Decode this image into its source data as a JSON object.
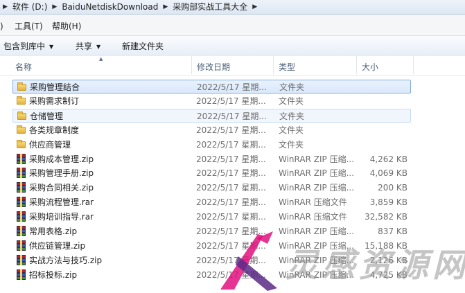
{
  "address_bar": {
    "crumbs": [
      "软件 (D:)",
      "BaiduNetdiskDownload",
      "采购部实战工具大全"
    ]
  },
  "menu": {
    "items": [
      ")",
      "工具(T)",
      "帮助(H)"
    ]
  },
  "toolbar": {
    "include_library": "包含到库中",
    "share": "共享",
    "new_folder": "新建文件夹"
  },
  "columns": {
    "name": "名称",
    "date": "修改日期",
    "type": "类型",
    "size": "大小"
  },
  "files": [
    {
      "name": "采购管理结合",
      "date": "2022/5/17 星期...",
      "type": "文件夹",
      "size": "",
      "icon": "folder-icon",
      "state": "selected"
    },
    {
      "name": "采购需求制订",
      "date": "2022/5/17 星期...",
      "type": "文件夹",
      "size": "",
      "icon": "folder-icon",
      "state": ""
    },
    {
      "name": "仓储管理",
      "date": "2022/5/17 星期...",
      "type": "文件夹",
      "size": "",
      "icon": "folder-icon",
      "state": "hover"
    },
    {
      "name": "各类规章制度",
      "date": "2022/5/17 星期...",
      "type": "文件夹",
      "size": "",
      "icon": "folder-icon",
      "state": ""
    },
    {
      "name": "供应商管理",
      "date": "2022/5/17 星期...",
      "type": "文件夹",
      "size": "",
      "icon": "folder-icon",
      "state": ""
    },
    {
      "name": "采购成本管理.zip",
      "date": "2022/5/17 星期...",
      "type": "WinRAR ZIP 压缩...",
      "size": "4,262 KB",
      "icon": "winrar-icon",
      "state": ""
    },
    {
      "name": "采购管理手册.zip",
      "date": "2022/5/17 星期...",
      "type": "WinRAR ZIP 压缩...",
      "size": "4,069 KB",
      "icon": "winrar-icon",
      "state": ""
    },
    {
      "name": "采购合同相关.zip",
      "date": "2022/5/17 星期...",
      "type": "WinRAR ZIP 压缩...",
      "size": "200 KB",
      "icon": "winrar-icon",
      "state": ""
    },
    {
      "name": "采购流程管理.rar",
      "date": "2022/5/17 星期...",
      "type": "WinRAR 压缩文件",
      "size": "3,859 KB",
      "icon": "winrar-icon",
      "state": ""
    },
    {
      "name": "采购培训指导.rar",
      "date": "2022/5/17 星期...",
      "type": "WinRAR 压缩文件",
      "size": "32,582 KB",
      "icon": "winrar-icon",
      "state": ""
    },
    {
      "name": "常用表格.zip",
      "date": "2022/5/17 星期...",
      "type": "WinRAR ZIP 压缩...",
      "size": "837 KB",
      "icon": "winrar-icon",
      "state": ""
    },
    {
      "name": "供应链管理.zip",
      "date": "2022/5/17 星期...",
      "type": "WinRAR ZIP 压缩...",
      "size": "15,188 KB",
      "icon": "winrar-icon",
      "state": ""
    },
    {
      "name": "实战方法与技巧.zip",
      "date": "2022/5/17 星期...",
      "type": "WinRAR ZIP 压缩...",
      "size": "2,126 KB",
      "icon": "winrar-icon",
      "state": ""
    },
    {
      "name": "招标投标.zip",
      "date": "2022/5/17 星期...",
      "type": "WinRAR ZIP 压缩...",
      "size": "4,725 KB",
      "icon": "winrar-icon",
      "state": ""
    }
  ],
  "watermark": {
    "text": "灵感资源网"
  },
  "colors": {
    "selected_border": "#84acdd",
    "watermark_pink": "#e0107e",
    "watermark_purple": "#5b2a86"
  }
}
